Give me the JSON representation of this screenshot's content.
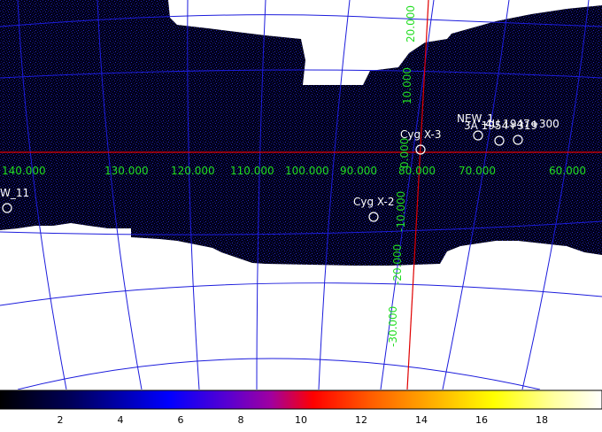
{
  "sources": [
    {
      "name": "W_11"
    },
    {
      "name": "Cyg X-2"
    },
    {
      "name": "Cyg X-3"
    },
    {
      "name": "NEW_1"
    },
    {
      "name": "3A 1954+319"
    },
    {
      "name": "4U 1947+300"
    }
  ],
  "longitude_labels": [
    "140.000",
    "130.000",
    "120.000",
    "110.000",
    "100.000",
    "90.000",
    "80.000",
    "70.000",
    "60.000"
  ],
  "latitude_labels": [
    "20.000",
    "10.000",
    "0.000",
    "-10.000",
    "-20.000",
    "-30.000"
  ],
  "colorbar": {
    "ticks": [
      "2",
      "4",
      "6",
      "8",
      "10",
      "12",
      "14",
      "16",
      "18"
    ],
    "range": [
      0,
      20
    ]
  },
  "colors": {
    "background_sky": "#000018",
    "grid": "#1c1cdc",
    "axis": "#e00000",
    "coord_label": "#22dd22",
    "source_marker": "#ffffff"
  }
}
